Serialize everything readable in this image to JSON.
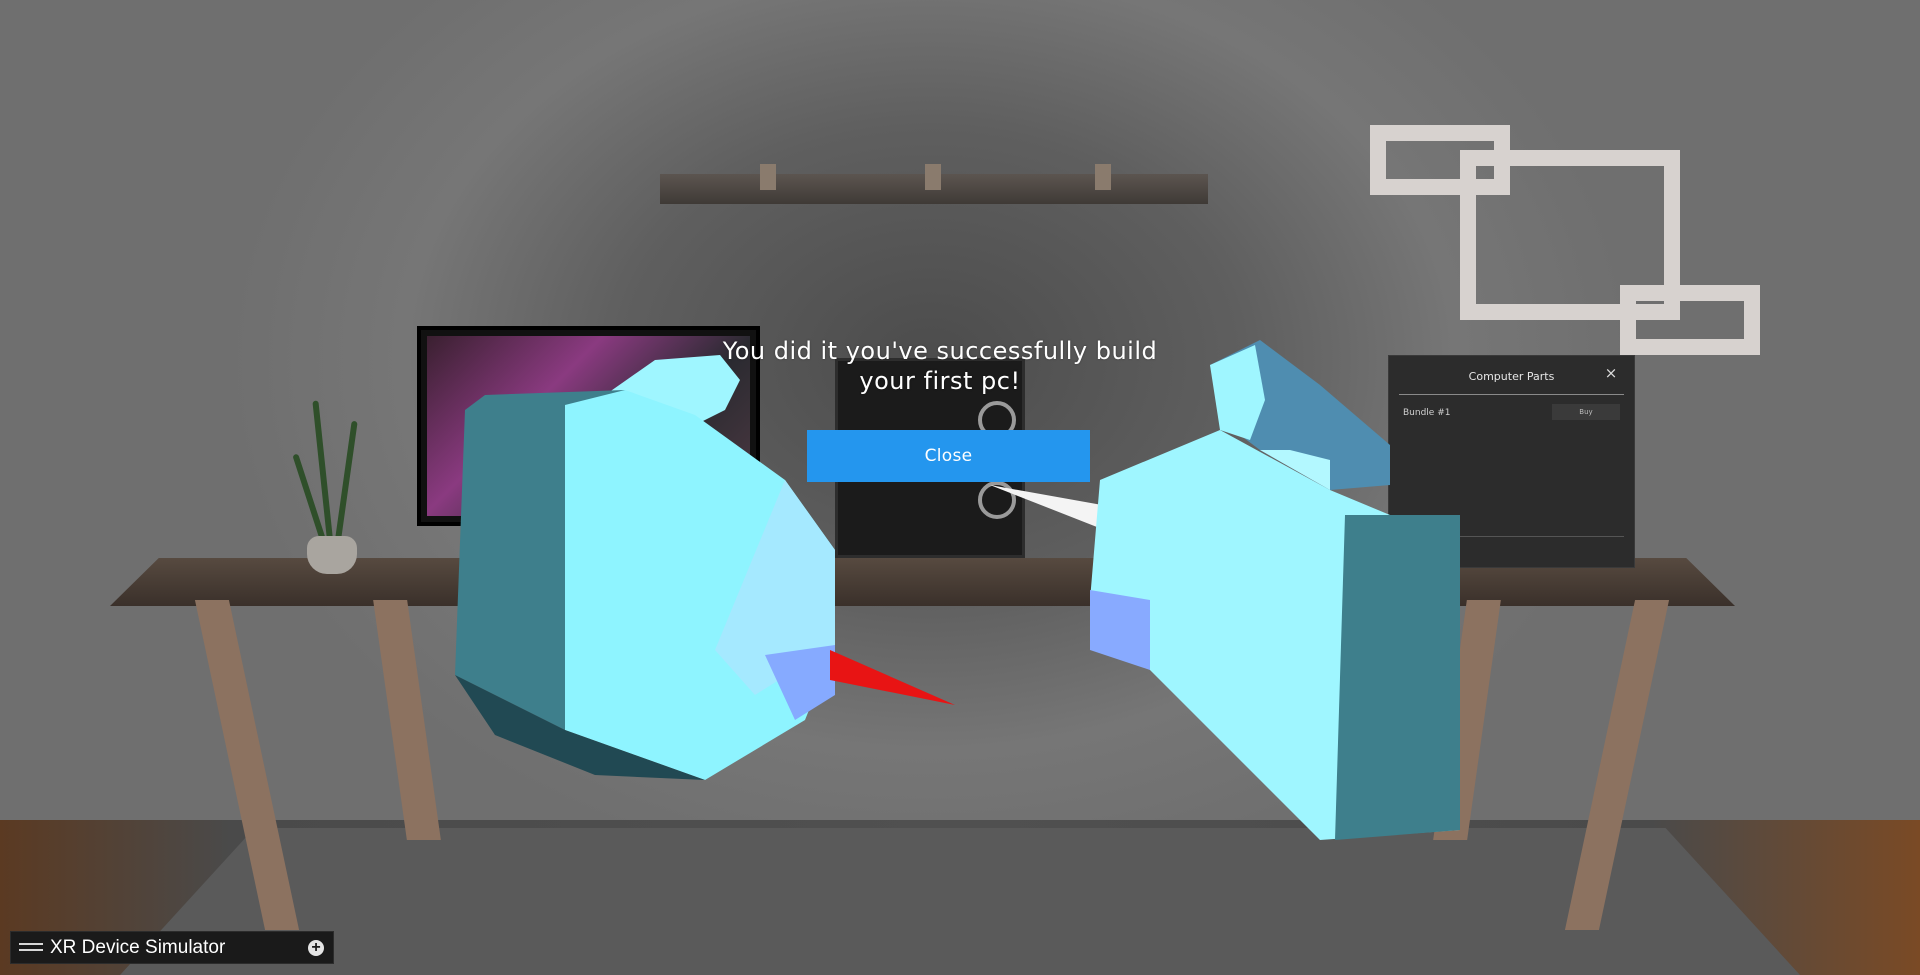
{
  "dialog": {
    "message": "You did it you've successfully build your first pc!",
    "close_label": "Close"
  },
  "computer_parts_panel": {
    "title": "Computer Parts",
    "close_glyph": "×",
    "items": [
      {
        "name": "Bundle #1",
        "action_label": "Buy"
      }
    ]
  },
  "xr_simulator": {
    "label": "XR Device Simulator",
    "drag_icon": "drag-handle-icon",
    "expand_icon": "plus-circle-icon",
    "expand_glyph": "+"
  },
  "colors": {
    "dialog_button": "#2496EE",
    "panel_bg": "#2C2C2C",
    "controller_light": "#8EF4FF",
    "controller_dark": "#3E7F8C",
    "ray_red": "#E81414"
  }
}
